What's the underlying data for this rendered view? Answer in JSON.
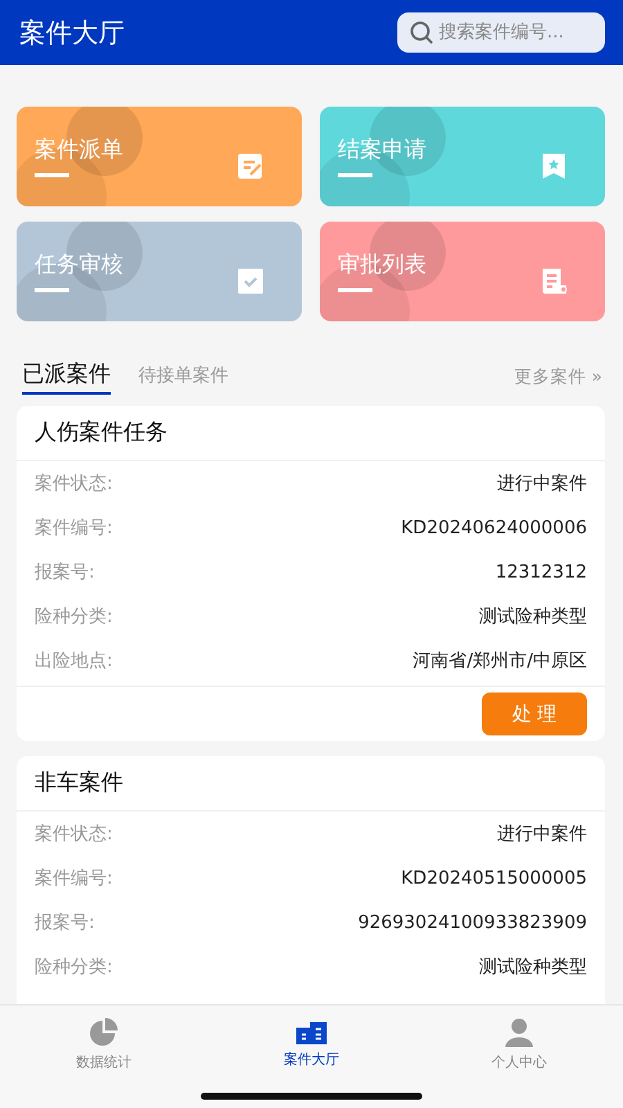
{
  "header": {
    "title": "案件大厅",
    "search": {
      "placeholder": "搜索案件编号..."
    }
  },
  "shortcuts": [
    {
      "label": "案件派单",
      "kind": "dispatch",
      "color": "#ffa857"
    },
    {
      "label": "结案申请",
      "kind": "close",
      "color": "#5fd8dc"
    },
    {
      "label": "任务审核",
      "kind": "review",
      "color": "#b3c6d8"
    },
    {
      "label": "审批列表",
      "kind": "approval",
      "color": "#ff9a9c"
    }
  ],
  "tabs": [
    {
      "label": "已派案件",
      "selected": true
    },
    {
      "label": "待接单案件",
      "selected": false
    }
  ],
  "more_link": "更多案件 »",
  "cases": [
    {
      "title": "人伤案件任务",
      "fields": [
        {
          "label": "案件状态:",
          "value": "进行中案件"
        },
        {
          "label": "案件编号:",
          "value": "KD20240624000006"
        },
        {
          "label": "报案号:",
          "value": "12312312"
        },
        {
          "label": "险种分类:",
          "value": "测试险种类型"
        },
        {
          "label": "出险地点:",
          "value": "河南省/郑州市/中原区"
        }
      ],
      "action": "处 理"
    },
    {
      "title": "非车案件",
      "fields": [
        {
          "label": "案件状态:",
          "value": "进行中案件"
        },
        {
          "label": "案件编号:",
          "value": "KD20240515000005"
        },
        {
          "label": "报案号:",
          "value": "92693024100933823909"
        },
        {
          "label": "险种分类:",
          "value": "测试险种类型"
        }
      ]
    }
  ],
  "bottom_nav": [
    {
      "label": "数据统计",
      "kind": "stats",
      "selected": false
    },
    {
      "label": "案件大厅",
      "kind": "hall",
      "selected": true
    },
    {
      "label": "个人中心",
      "kind": "profile",
      "selected": false
    }
  ]
}
